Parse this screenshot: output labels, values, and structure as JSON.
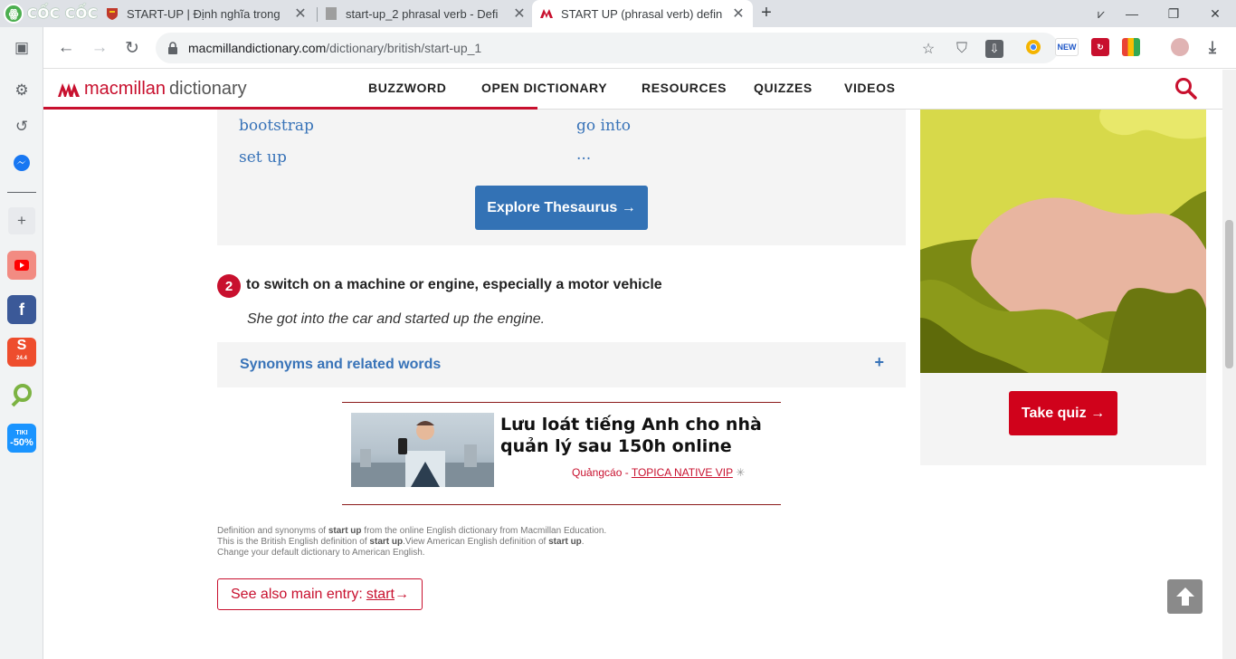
{
  "browser": {
    "brand": "CỐC CỐC",
    "tabs": [
      {
        "title": "START-UP | Định nghĩa trong",
        "active": false
      },
      {
        "title": "start-up_2 phrasal verb - Defi",
        "active": false
      },
      {
        "title": "START UP (phrasal verb) defin",
        "active": true
      }
    ],
    "url_host": "macmillandictionary.com",
    "url_path": "/dictionary/british/start-up_1",
    "extensions": {
      "new_badge": "NEW"
    }
  },
  "sidebar": {
    "icons": [
      "settings-icon",
      "history-icon",
      "messenger-icon",
      "add-icon"
    ],
    "apps": [
      {
        "name": "youtube",
        "color": "#f28b82"
      },
      {
        "name": "facebook",
        "color": "#3b5998"
      },
      {
        "name": "shopee",
        "label": "24.4",
        "color": "#ee4d2d"
      },
      {
        "name": "green-app",
        "color": "#7cb342"
      },
      {
        "name": "tiki",
        "label": "-50%",
        "sublabel": "TIKI",
        "color": "#1a94ff"
      }
    ]
  },
  "site": {
    "logo_name": "macmillan",
    "logo_dict": "dictionary",
    "nav": [
      "BUZZWORD",
      "OPEN DICTIONARY",
      "RESOURCES",
      "QUIZZES",
      "VIDEOS"
    ],
    "accent": "#c8102e"
  },
  "thesaurus": {
    "links": [
      "bootstrap",
      "go into",
      "set up",
      "..."
    ],
    "button": "Explore Thesaurus →"
  },
  "sense": {
    "number": "2",
    "definition": "to switch on a machine or engine, especially a motor vehicle",
    "example": "She got into the car and started up the engine."
  },
  "synonyms": {
    "label": "Synonyms and related words",
    "toggle": "+"
  },
  "ad": {
    "title": "Lưu loát tiếng Anh cho nhà quản lý sau 150h online",
    "source_prefix": "Quảngcáo - ",
    "source": "TOPICA NATIVE VIP"
  },
  "footnote": {
    "line1_a": "Definition and synonyms of ",
    "line1_b": "start up",
    "line1_c": " from the online English dictionary from Macmillan Education.",
    "line2_a": "This is the British English definition of ",
    "line2_b": "start up",
    "line2_c": ".View American English definition of ",
    "line2_d": "start up",
    "line2_e": ".",
    "line3": "Change your default dictionary to American English."
  },
  "see_also": {
    "prefix": "See also main entry:",
    "link": "start",
    "arrow": "→"
  },
  "quiz": {
    "button": "Take quiz →"
  }
}
